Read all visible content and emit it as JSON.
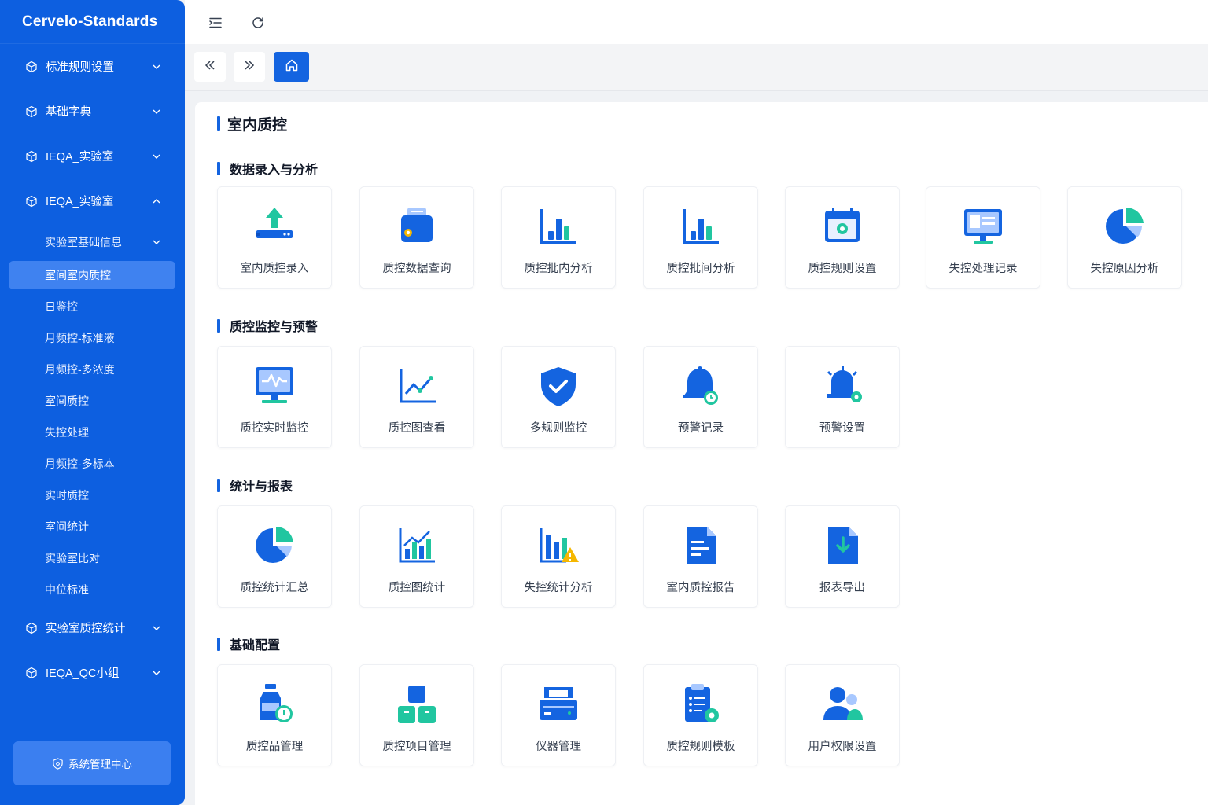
{
  "app": {
    "brand": "Cervelo-Standards"
  },
  "sidebar": {
    "groups_top": [
      {
        "label": "标准规则设置",
        "expanded": false
      },
      {
        "label": "基础字典",
        "expanded": false
      },
      {
        "label": "IEQA_实验室",
        "expanded": false
      },
      {
        "label": "IEQA_实验室",
        "expanded": true
      }
    ],
    "sub_items": [
      {
        "label": "实验室基础信息",
        "has_children": true
      },
      {
        "label": "室间室内质控",
        "active": true
      },
      {
        "label": "日鉴控"
      },
      {
        "label": "月频控-标准液"
      },
      {
        "label": "月频控-多浓度"
      },
      {
        "label": "室间质控"
      },
      {
        "label": "失控处理"
      },
      {
        "label": "月频控-多标本"
      },
      {
        "label": "实时质控"
      },
      {
        "label": "室间统计"
      },
      {
        "label": "实验室比对"
      },
      {
        "label": "中位标准"
      }
    ],
    "groups_bottom": [
      {
        "label": "实验室质控统计",
        "expanded": false
      },
      {
        "label": "IEQA_QC小组",
        "expanded": false
      }
    ],
    "system_button": "系统管理中心"
  },
  "topbar": {
    "icons": [
      "menu-fold-icon",
      "refresh-icon"
    ]
  },
  "tabbar": {
    "icons": [
      "double-left-icon",
      "double-right-icon",
      "home-icon"
    ]
  },
  "page": {
    "title": "室内质控"
  },
  "sections": [
    {
      "title": "数据录入与分析",
      "cards": [
        {
          "label": "室内质控录入",
          "icon": "upload-icon"
        },
        {
          "label": "质控数据查询",
          "icon": "data-query-icon"
        },
        {
          "label": "质控批内分析",
          "icon": "bar-chart-icon"
        },
        {
          "label": "质控批间分析",
          "icon": "bar-chart-icon"
        },
        {
          "label": "质控规则设置",
          "icon": "calendar-settings-icon"
        },
        {
          "label": "失控处理记录",
          "icon": "monitor-record-icon"
        },
        {
          "label": "失控原因分析",
          "icon": "pie-chart-icon"
        }
      ]
    },
    {
      "title": "质控监控与预警",
      "cards": [
        {
          "label": "质控实时监控",
          "icon": "monitor-pulse-icon"
        },
        {
          "label": "质控图查看",
          "icon": "line-chart-icon"
        },
        {
          "label": "多规则监控",
          "icon": "shield-check-icon"
        },
        {
          "label": "预警记录",
          "icon": "bell-clock-icon"
        },
        {
          "label": "预警设置",
          "icon": "alarm-settings-icon"
        }
      ]
    },
    {
      "title": "统计与报表",
      "cards": [
        {
          "label": "质控统计汇总",
          "icon": "pie-chart-icon"
        },
        {
          "label": "质控图统计",
          "icon": "bar-line-chart-icon"
        },
        {
          "label": "失控统计分析",
          "icon": "bar-warning-icon"
        },
        {
          "label": "室内质控报告",
          "icon": "document-icon"
        },
        {
          "label": "报表导出",
          "icon": "file-download-icon"
        }
      ]
    },
    {
      "title": "基础配置",
      "cards": [
        {
          "label": "质控品管理",
          "icon": "bottle-clock-icon"
        },
        {
          "label": "质控项目管理",
          "icon": "boxes-icon"
        },
        {
          "label": "仪器管理",
          "icon": "printer-icon"
        },
        {
          "label": "质控规则模板",
          "icon": "clipboard-settings-icon"
        },
        {
          "label": "用户权限设置",
          "icon": "users-icon"
        }
      ]
    }
  ],
  "colors": {
    "primary": "#1464e0",
    "sidebar": "#0d5fe0",
    "accent_green": "#21c6a0",
    "warning": "#f5b700"
  }
}
